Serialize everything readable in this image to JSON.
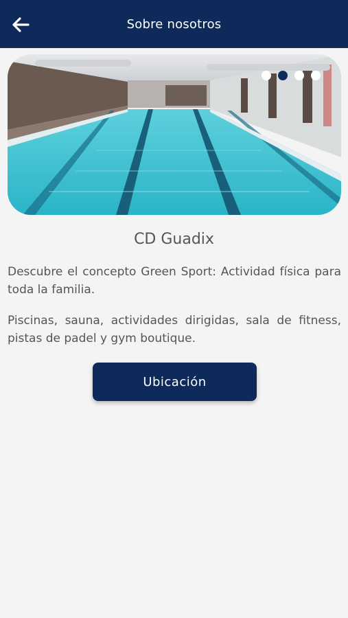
{
  "header": {
    "title": "Sobre nosotros",
    "back_icon": "arrow-left-icon"
  },
  "carousel": {
    "image_description": "indoor swimming pool",
    "slide_count": 4,
    "active_index": 1
  },
  "club": {
    "name": "CD Guadix"
  },
  "description": {
    "paragraph1": "Descubre el concepto Green Sport: Actividad física para toda la familia.",
    "paragraph2": "Piscinas, sauna, actividades dirigidas, sala de fitness, pistas de padel y gym boutique."
  },
  "actions": {
    "location_label": "Ubicación"
  },
  "colors": {
    "primary": "#0d2a5a",
    "background": "#f4f4f4",
    "text": "#555555"
  }
}
